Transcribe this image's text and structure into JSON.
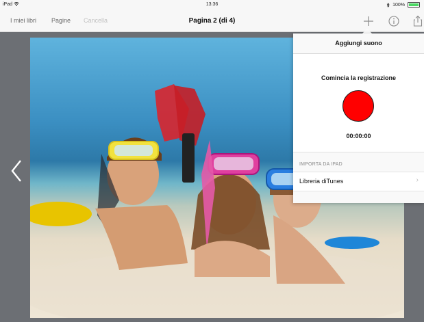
{
  "status_bar": {
    "device": "iPad",
    "time": "13:36",
    "battery": "100%"
  },
  "nav_bar": {
    "back_label": "I miei libri",
    "pages_label": "Pagine",
    "cancel_label": "Cancella",
    "title": "Pagina 2 (di 4)"
  },
  "popover": {
    "title": "Aggiungi suono",
    "record_label": "Comincia la registrazione",
    "timer": "00:00:00",
    "import_header": "IMPORTA DA IPAD",
    "library_label": "Libreria diTunes",
    "chevron": "›"
  },
  "colors": {
    "record": "#ff0000",
    "background": "#6c6f74",
    "battery": "#4cd964"
  },
  "icons": [
    "wifi-icon",
    "bluetooth-icon",
    "battery-icon",
    "plus-icon",
    "info-icon",
    "share-icon",
    "chevron-left-icon",
    "chevron-right-icon"
  ]
}
